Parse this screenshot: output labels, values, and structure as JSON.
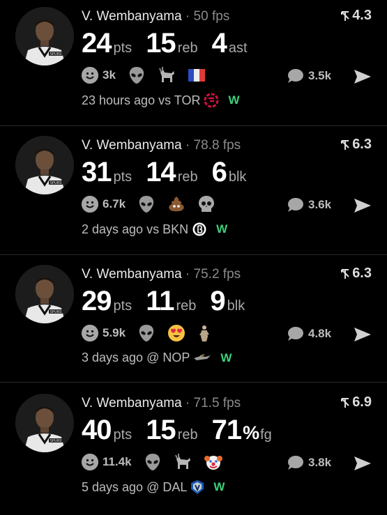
{
  "posts": [
    {
      "player": "V. Wembanyama",
      "separator": "·",
      "fps": "50 fps",
      "rating": "4.3",
      "stats": [
        {
          "value": "24",
          "unit": "pts"
        },
        {
          "value": "15",
          "unit": "reb"
        },
        {
          "value": "4",
          "unit": "ast"
        }
      ],
      "reaction_count": "3k",
      "emojis": [
        "alien-emoji",
        "goat-emoji",
        "france-flag-emoji"
      ],
      "comments": "3.5k",
      "time": "23 hours ago",
      "matchup": "vs TOR",
      "opponent_logo": "raptors-logo",
      "result": "W"
    },
    {
      "player": "V. Wembanyama",
      "separator": "·",
      "fps": "78.8 fps",
      "rating": "6.3",
      "stats": [
        {
          "value": "31",
          "unit": "pts"
        },
        {
          "value": "14",
          "unit": "reb"
        },
        {
          "value": "6",
          "unit": "blk"
        }
      ],
      "reaction_count": "6.7k",
      "emojis": [
        "alien-emoji",
        "poop-emoji",
        "skull-emoji"
      ],
      "comments": "3.6k",
      "time": "2 days ago",
      "matchup": "vs BKN",
      "opponent_logo": "nets-logo",
      "result": "W"
    },
    {
      "player": "V. Wembanyama",
      "separator": "·",
      "fps": "75.2 fps",
      "rating": "6.3",
      "stats": [
        {
          "value": "29",
          "unit": "pts"
        },
        {
          "value": "11",
          "unit": "reb"
        },
        {
          "value": "9",
          "unit": "blk"
        }
      ],
      "reaction_count": "5.9k",
      "emojis": [
        "alien-emoji",
        "heart-eyes-emoji",
        "statue-emoji"
      ],
      "comments": "4.8k",
      "time": "3 days ago",
      "matchup": "@ NOP",
      "opponent_logo": "pelicans-logo",
      "result": "W"
    },
    {
      "player": "V. Wembanyama",
      "separator": "·",
      "fps": "71.5 fps",
      "rating": "6.9",
      "stats": [
        {
          "value": "40",
          "unit": "pts"
        },
        {
          "value": "15",
          "unit": "reb"
        },
        {
          "value": "71",
          "pct": "%",
          "unit": "fg"
        }
      ],
      "reaction_count": "11.4k",
      "emojis": [
        "alien-emoji",
        "goat-emoji",
        "clown-emoji"
      ],
      "comments": "3.8k",
      "time": "5 days ago",
      "matchup": "@ DAL",
      "opponent_logo": "mavericks-logo",
      "result": "W"
    }
  ],
  "colors": {
    "win": "#3bd07a",
    "background": "#000000",
    "raptors": "#ce1141"
  }
}
